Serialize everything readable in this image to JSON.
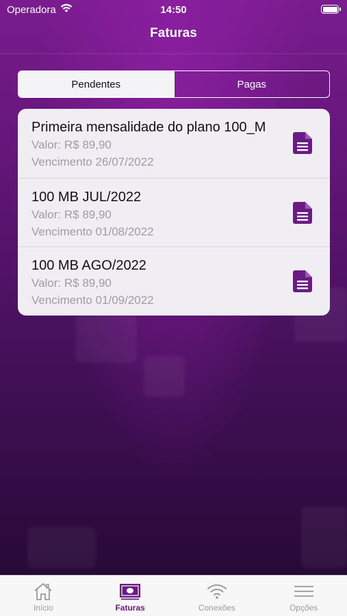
{
  "status_bar": {
    "carrier": "Operadora",
    "time": "14:50"
  },
  "header": {
    "title": "Faturas"
  },
  "segments": [
    {
      "label": "Pendentes",
      "selected": true
    },
    {
      "label": "Pagas",
      "selected": false
    }
  ],
  "invoices": [
    {
      "title": "Primeira mensalidade do plano 100_M",
      "value": "Valor: R$ 89,90",
      "due": "Vencimento 26/07/2022",
      "icon": "document-icon"
    },
    {
      "title": "100 MB JUL/2022",
      "value": "Valor: R$ 89,90",
      "due": "Vencimento 01/08/2022",
      "icon": "document-icon"
    },
    {
      "title": "100 MB AGO/2022",
      "value": "Valor: R$ 89,90",
      "due": "Vencimento 01/09/2022",
      "icon": "document-icon"
    }
  ],
  "tabs": [
    {
      "label": "Início",
      "icon": "home-icon",
      "active": false
    },
    {
      "label": "Faturas",
      "icon": "invoice-money-icon",
      "active": true
    },
    {
      "label": "Conexões",
      "icon": "wifi-icon",
      "active": false
    },
    {
      "label": "Opções",
      "icon": "menu-icon",
      "active": false
    }
  ],
  "colors": {
    "accent": "#6a1b84",
    "background_top": "#7a1c8e",
    "background_bottom": "#220830"
  }
}
